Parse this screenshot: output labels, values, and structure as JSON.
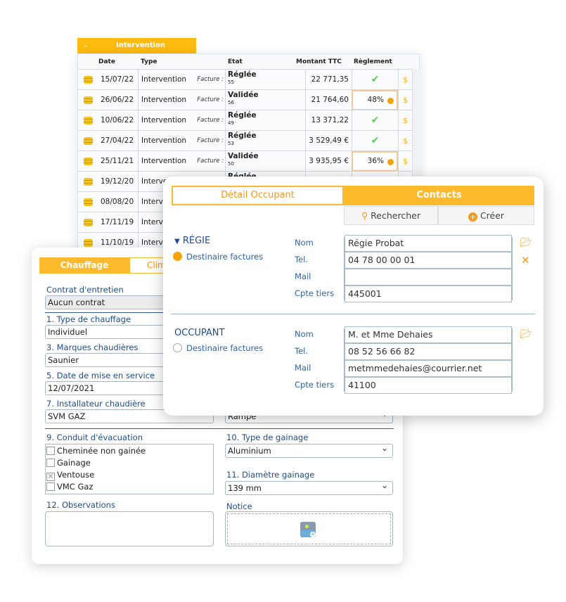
{
  "interventions": {
    "tab_label": "Intervention",
    "headers": {
      "date": "Date",
      "type": "Type",
      "etat": "Etat",
      "montant": "Montant TTC",
      "reglement": "Règlement"
    },
    "facture_label": "Facture :",
    "rows": [
      {
        "date": "15/07/22",
        "type": "Intervention",
        "etat": "Réglée",
        "num": "55",
        "montant": "22 771,35 €",
        "reglement": "check"
      },
      {
        "date": "26/06/22",
        "type": "Intervention",
        "etat": "Validée",
        "num": "56",
        "montant": "21 764,60 €",
        "reglement": "48%"
      },
      {
        "date": "10/06/22",
        "type": "Intervention",
        "etat": "Réglée",
        "num": "49",
        "montant": "13 371,22 €",
        "reglement": "check"
      },
      {
        "date": "27/04/22",
        "type": "Intervention",
        "etat": "Réglée",
        "num": "53",
        "montant": "3 529,49 €",
        "reglement": "check"
      },
      {
        "date": "25/11/21",
        "type": "Intervention",
        "etat": "Validée",
        "num": "50",
        "montant": "3 935,95 €",
        "reglement": "36%"
      },
      {
        "date": "19/12/20",
        "type": "Interve",
        "etat": "Réglée",
        "num": "",
        "montant": "",
        "reglement": ""
      },
      {
        "date": "08/08/20",
        "type": "Interve",
        "etat": "",
        "num": "",
        "montant": "",
        "reglement": ""
      },
      {
        "date": "17/11/19",
        "type": "Interve",
        "etat": "",
        "num": "",
        "montant": "",
        "reglement": ""
      },
      {
        "date": "11/10/19",
        "type": "Interve",
        "etat": "",
        "num": "",
        "montant": "",
        "reglement": ""
      }
    ]
  },
  "chauffage": {
    "tabs": [
      "Chauffage",
      "Clim"
    ],
    "contrat_label": "Contrat  d'entretien",
    "contrat_value": "Aucun contrat",
    "f1_label": "1. Type de chauffage",
    "f1_value": "Individuel",
    "f3_label": "3. Marques chaudières",
    "f3_value": "Saunier",
    "f5_label": "5. Date de mise en service",
    "f5_value": "12/07/2021",
    "f7_label": "7. Installateur chaudière",
    "f7_value": "SVM GAZ",
    "f8_value": "Rampe",
    "f9_label": "9. Conduit d'évacuation",
    "f9_options": [
      {
        "label": "Cheminée non gainée",
        "checked": false
      },
      {
        "label": "Gainage",
        "checked": false
      },
      {
        "label": "Ventouse",
        "checked": true
      },
      {
        "label": "VMC Gaz",
        "checked": false
      }
    ],
    "f10_label": "10. Type de gainage",
    "f10_value": "Aluminium",
    "f11_label": "11. Diamètre gainage",
    "f11_value": "139 mm",
    "f12_label": "12. Observations",
    "f12_value": "",
    "notice_label": "Notice"
  },
  "contacts": {
    "tabs": [
      "Détail Occupant",
      "Contacts"
    ],
    "search_label": "Rechercher",
    "create_label": "Créer",
    "field_labels": [
      "Nom",
      "Tel.",
      "Mail",
      "Cpte tiers"
    ],
    "dest_label": "Destinaire factures",
    "regie": {
      "title": "RÉGIE",
      "nom": "Régie Probat",
      "tel": "04 78 00 00 01",
      "mail": "",
      "cpte": "445001",
      "destinataire": true
    },
    "occupant": {
      "title": "OCCUPANT",
      "nom": "M. et Mme Dehaies",
      "tel": "08 52 56 66 82",
      "mail": "metmmedehaies@courrier.net",
      "cpte": "41100",
      "destinataire": false
    }
  },
  "colors": {
    "accent": "#fdba0f",
    "label_blue": "#1e4b8f",
    "orange_text": "#f39a1d"
  }
}
